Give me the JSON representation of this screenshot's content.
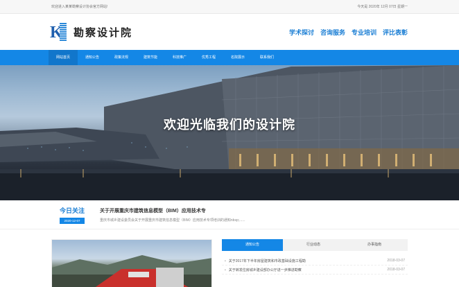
{
  "topbar": {
    "welcome": "欢迎进入某某勘察设计协会官方网站!",
    "date": "今天是 2020年 12月 07日 星期一"
  },
  "header": {
    "logo_text": "勘察设计院",
    "links": [
      "学术探讨",
      "咨询服务",
      "专业培训",
      "评比表彰"
    ]
  },
  "nav": {
    "items": [
      "网站首页",
      "通知公告",
      "政策法规",
      "建筑节能",
      "科技推广",
      "优秀工程",
      "名院展示",
      "联系我们"
    ]
  },
  "hero": {
    "title": "欢迎光临我们的设计院"
  },
  "announcement": {
    "heading": "今日关注",
    "date": "2020-12-07",
    "title": "关于开展重庆市建筑信息模型（BIM）应用技术专",
    "summary": "重庆市城乡建设委员会关于开展重庆市建筑信息模型（BIM）应用技术专项培训的通知nbsp;......"
  },
  "tabs": {
    "items": [
      "通知公告",
      "行业动态",
      "办事指南"
    ],
    "active": 0
  },
  "news": [
    {
      "title": "关于2017年下半年房屋建筑和市政基础设施工程勘",
      "date": "2018-03-07"
    },
    {
      "title": "关于转发住房城乡建设部办公厅进一步推进勘察",
      "date": "2018-03-07"
    }
  ],
  "colors": {
    "brand_blue": "#1487e6",
    "link_blue": "#1a7ed4"
  }
}
